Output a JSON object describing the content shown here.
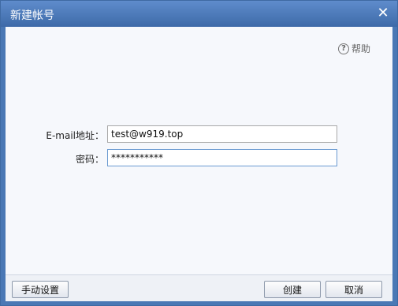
{
  "dialog": {
    "title": "新建帐号",
    "close_glyph": "✕",
    "help": {
      "icon": "help-circle-icon",
      "label": "帮助"
    }
  },
  "form": {
    "email": {
      "label": "E-mail地址：",
      "value": "test@w919.top"
    },
    "password": {
      "label": "密码：",
      "value": "***********"
    }
  },
  "footer": {
    "manual_label": "手动设置",
    "create_label": "创建",
    "cancel_label": "取消"
  },
  "colors": {
    "titlebar": "#4a78b5",
    "content_bg": "#f6f8fc"
  }
}
